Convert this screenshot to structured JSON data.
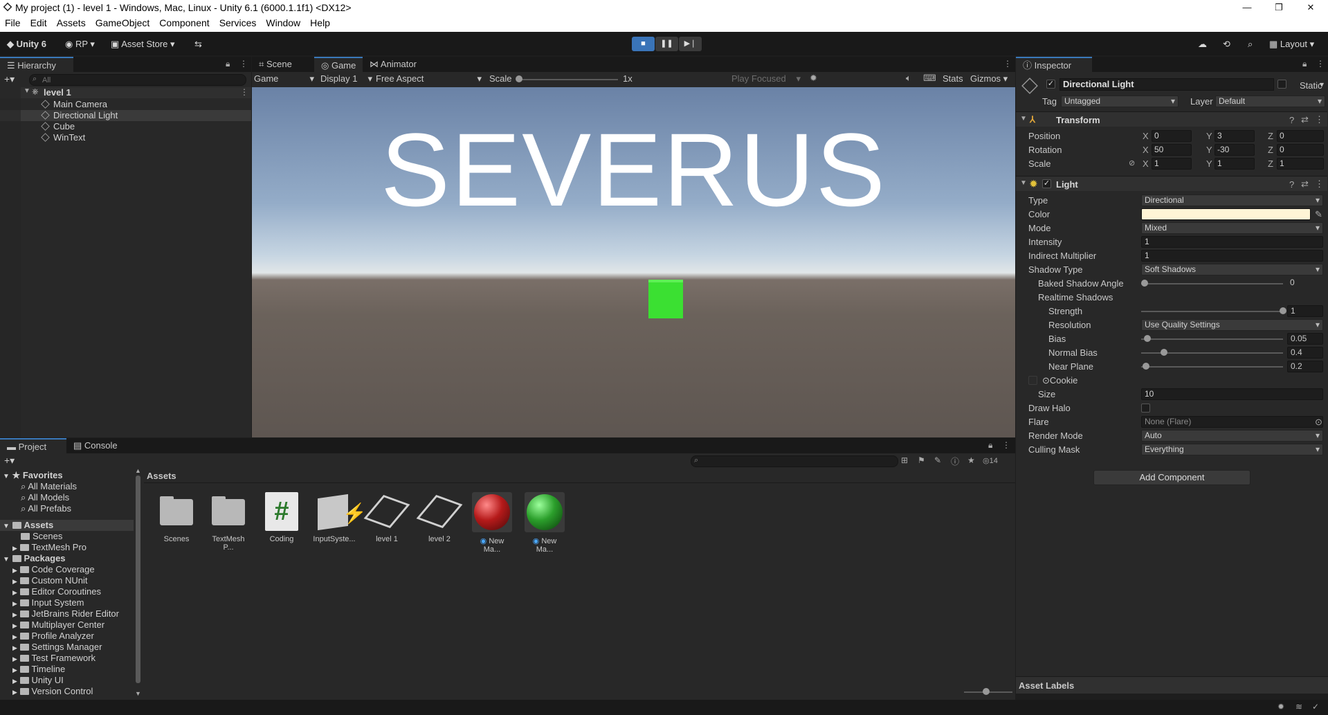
{
  "window": {
    "title": "My project (1) - level 1 - Windows, Mac, Linux - Unity 6.1 (6000.1.1f1) <DX12>"
  },
  "menu": [
    "File",
    "Edit",
    "Assets",
    "GameObject",
    "Component",
    "Services",
    "Window",
    "Help"
  ],
  "toolbar": {
    "unity_label": "Unity 6",
    "rp_label": "RP",
    "asset_store_label": "Asset Store",
    "layout_label": "Layout"
  },
  "hierarchy": {
    "tab": "Hierarchy",
    "search_placeholder": "All",
    "scene": "level 1",
    "items": [
      "Main Camera",
      "Directional Light",
      "Cube",
      "WinText"
    ]
  },
  "game_view": {
    "tabs": [
      "Scene",
      "Game",
      "Animator"
    ],
    "mode": "Game",
    "display": "Display 1",
    "aspect": "Free Aspect",
    "scale_label": "Scale",
    "scale_value": "1x",
    "play_focused": "Play Focused",
    "stats": "Stats",
    "gizmos": "Gizmos",
    "scene_text": "SEVERUS",
    "cube_color": "#3be032"
  },
  "inspector": {
    "tab": "Inspector",
    "object_name": "Directional Light",
    "static_label": "Static",
    "tag_label": "Tag",
    "tag_value": "Untagged",
    "layer_label": "Layer",
    "layer_value": "Default",
    "transform": {
      "header": "Transform",
      "rows": [
        {
          "label": "Position",
          "x": "0",
          "y": "3",
          "z": "0"
        },
        {
          "label": "Rotation",
          "x": "50",
          "y": "-30",
          "z": "0"
        },
        {
          "label": "Scale",
          "x": "1",
          "y": "1",
          "z": "1"
        }
      ]
    },
    "light": {
      "header": "Light",
      "type_label": "Type",
      "type_value": "Directional",
      "color_label": "Color",
      "color_value": "#fff4d6",
      "mode_label": "Mode",
      "mode_value": "Mixed",
      "intensity_label": "Intensity",
      "intensity_value": "1",
      "indirect_label": "Indirect Multiplier",
      "indirect_value": "1",
      "shadow_type_label": "Shadow Type",
      "shadow_type_value": "Soft Shadows",
      "baked_angle_label": "Baked Shadow Angle",
      "baked_angle_value": "0",
      "realtime_label": "Realtime Shadows",
      "strength_label": "Strength",
      "strength_value": "1",
      "resolution_label": "Resolution",
      "resolution_value": "Use Quality Settings",
      "bias_label": "Bias",
      "bias_value": "0.05",
      "normal_bias_label": "Normal Bias",
      "normal_bias_value": "0.4",
      "near_plane_label": "Near Plane",
      "near_plane_value": "0.2",
      "cookie_label": "Cookie",
      "size_label": "Size",
      "size_value": "10",
      "draw_halo_label": "Draw Halo",
      "flare_label": "Flare",
      "flare_value": "None (Flare)",
      "render_mode_label": "Render Mode",
      "render_mode_value": "Auto",
      "culling_label": "Culling Mask",
      "culling_value": "Everything"
    },
    "add_component": "Add Component",
    "asset_labels": "Asset Labels"
  },
  "project": {
    "tabs": [
      "Project",
      "Console"
    ],
    "count": "14",
    "favorites_label": "Favorites",
    "favorites": [
      "All Materials",
      "All Models",
      "All Prefabs"
    ],
    "assets_label": "Assets",
    "asset_folders": [
      "Scenes",
      "TextMesh Pro"
    ],
    "packages_label": "Packages",
    "packages": [
      "Code Coverage",
      "Custom NUnit",
      "Editor Coroutines",
      "Input System",
      "JetBrains Rider Editor",
      "Multiplayer Center",
      "Profile Analyzer",
      "Settings Manager",
      "Test Framework",
      "Timeline",
      "Unity UI",
      "Version Control"
    ],
    "breadcrumb": "Assets",
    "grid": [
      "Scenes",
      "TextMesh P...",
      "Coding",
      "InputSyste...",
      "level 1",
      "level 2",
      "New Ma...",
      "New Ma..."
    ],
    "red_material": "#b51a1a",
    "green_material": "#2b9e2b"
  }
}
